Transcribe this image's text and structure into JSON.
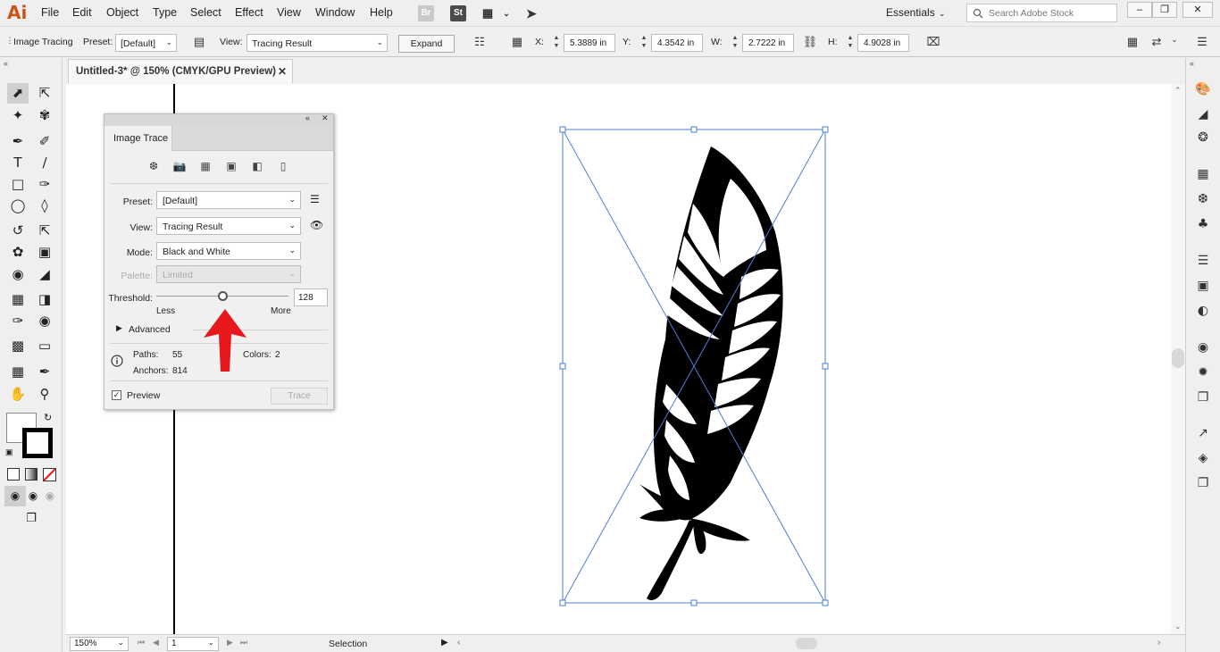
{
  "menubar": {
    "logo": "Ai",
    "items": [
      "File",
      "Edit",
      "Object",
      "Type",
      "Select",
      "Effect",
      "View",
      "Window",
      "Help"
    ],
    "bridge_label": "Br",
    "stock_label": "St",
    "workspace": "Essentials",
    "search_placeholder": "Search Adobe Stock"
  },
  "control": {
    "mode_label": "Image Tracing",
    "preset_label": "Preset:",
    "preset_value": "[Default]",
    "view_label": "View:",
    "view_value": "Tracing Result",
    "expand_label": "Expand",
    "x_label": "X:",
    "x_value": "5.3889 in",
    "y_label": "Y:",
    "y_value": "4.3542 in",
    "w_label": "W:",
    "w_value": "2.7222 in",
    "h_label": "H:",
    "h_value": "4.9028 in"
  },
  "document": {
    "tab_title": "Untitled-3* @ 150% (CMYK/GPU Preview)"
  },
  "image_trace": {
    "tab_title": "Image Trace",
    "preset_label": "Preset:",
    "preset_value": "[Default]",
    "view_label": "View:",
    "view_value": "Tracing Result",
    "mode_label": "Mode:",
    "mode_value": "Black and White",
    "palette_label": "Palette:",
    "palette_value": "Limited",
    "threshold_label": "Threshold:",
    "threshold_value": "128",
    "threshold_min": 0,
    "threshold_max": 255,
    "less_label": "Less",
    "more_label": "More",
    "advanced_label": "Advanced",
    "paths_label": "Paths:",
    "paths_value": "55",
    "colors_label": "Colors:",
    "colors_value": "2",
    "anchors_label": "Anchors:",
    "anchors_value": "814",
    "preview_label": "Preview",
    "preview_checked": true,
    "trace_label": "Trace"
  },
  "status": {
    "zoom": "150%",
    "page": "1",
    "tool": "Selection"
  },
  "colors": {
    "selection_blue": "#4a7fd4",
    "annotation_red": "#e8171c",
    "ai_orange": "#c8561a"
  }
}
